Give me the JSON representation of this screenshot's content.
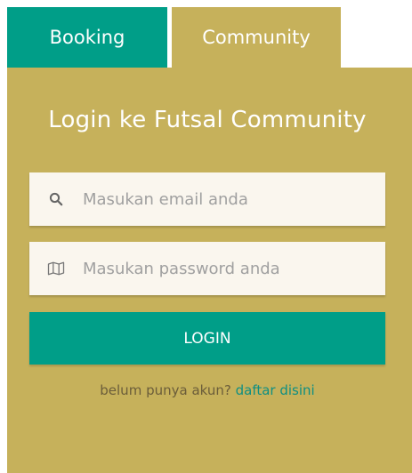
{
  "tabs": {
    "booking_label": "Booking",
    "community_label": "Community"
  },
  "login": {
    "title": "Login ke Futsal Community",
    "email_placeholder": "Masukan email anda",
    "password_placeholder": "Masukan password anda",
    "submit_label": "LOGIN",
    "register_prompt": "belum punya akun?",
    "register_link": "daftar disini"
  },
  "icons": {
    "email_field_icon": "search-icon",
    "password_field_icon": "map-icon"
  },
  "colors": {
    "primary_teal": "#009e88",
    "panel_gold": "#c6b15b",
    "input_bg": "#faf6ee",
    "link_teal": "#0f8f82"
  }
}
